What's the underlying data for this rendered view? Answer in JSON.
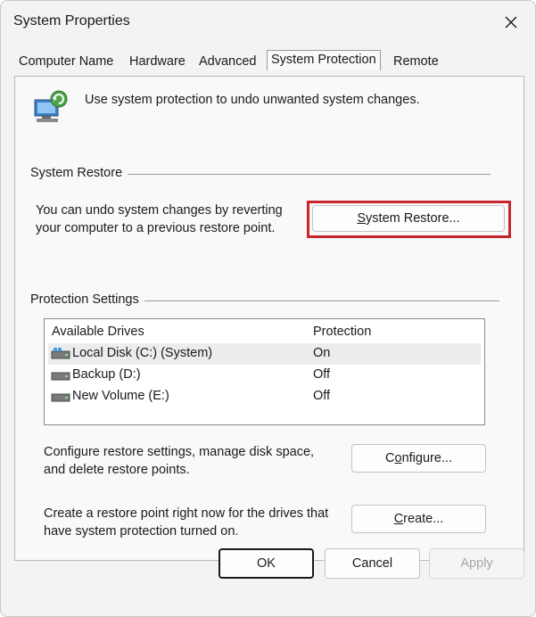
{
  "window": {
    "title": "System Properties"
  },
  "tabs": [
    {
      "label": "Computer Name",
      "active": false
    },
    {
      "label": "Hardware",
      "active": false
    },
    {
      "label": "Advanced",
      "active": false
    },
    {
      "label": "System Protection",
      "active": true
    },
    {
      "label": "Remote",
      "active": false
    }
  ],
  "intro": {
    "text": "Use system protection to undo unwanted system changes.",
    "icon": "system-protection-icon"
  },
  "system_restore": {
    "group_label": "System Restore",
    "description_line1": "You can undo system changes by reverting",
    "description_line2": "your computer to a previous restore point.",
    "button_label_accel": "S",
    "button_label_rest": "ystem Restore...",
    "highlight_color": "#c8262d"
  },
  "protection_settings": {
    "group_label": "Protection Settings",
    "columns": [
      "Available Drives",
      "Protection"
    ],
    "drives": [
      {
        "name": "Local Disk (C:) (System)",
        "protection": "On",
        "icon": "system-drive-icon",
        "selected": true
      },
      {
        "name": "Backup (D:)",
        "protection": "Off",
        "icon": "drive-icon",
        "selected": false
      },
      {
        "name": "New Volume (E:)",
        "protection": "Off",
        "icon": "drive-icon",
        "selected": false
      }
    ],
    "configure": {
      "description_line1": "Configure restore settings, manage disk space,",
      "description_line2": "and delete restore points.",
      "button_pre": "C",
      "button_accel": "o",
      "button_post": "nfigure..."
    },
    "create": {
      "description_line1": "Create a restore point right now for the drives that",
      "description_line2": "have system protection turned on.",
      "button_pre": "",
      "button_accel": "C",
      "button_post": "reate..."
    }
  },
  "footer": {
    "ok_label": "OK",
    "cancel_label": "Cancel",
    "apply_pre": "",
    "apply_accel": "A",
    "apply_post": "pply"
  }
}
